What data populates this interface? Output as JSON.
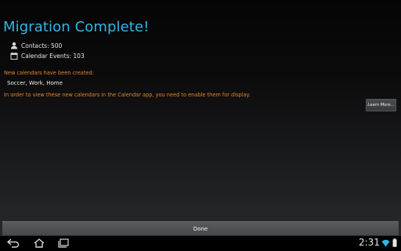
{
  "header": {
    "title": "Migration Complete!"
  },
  "stats": {
    "contacts": "Contacts: 500",
    "calendar_events": "Calendar Events: 103"
  },
  "calendars": {
    "heading": "New calendars have been created:",
    "list": "Soccer, Work, Home",
    "enable_note": "In order to view these new calendars in the Calendar app, you need to enable them for display."
  },
  "buttons": {
    "learn_more": "Learn More...",
    "done": "Done"
  },
  "status_bar": {
    "time": "2:31",
    "icons": [
      "back-icon",
      "home-icon",
      "recent-apps-icon",
      "wifi-icon",
      "battery-icon"
    ]
  },
  "colors": {
    "title": "#33b5e5",
    "notice": "#e0852a"
  }
}
